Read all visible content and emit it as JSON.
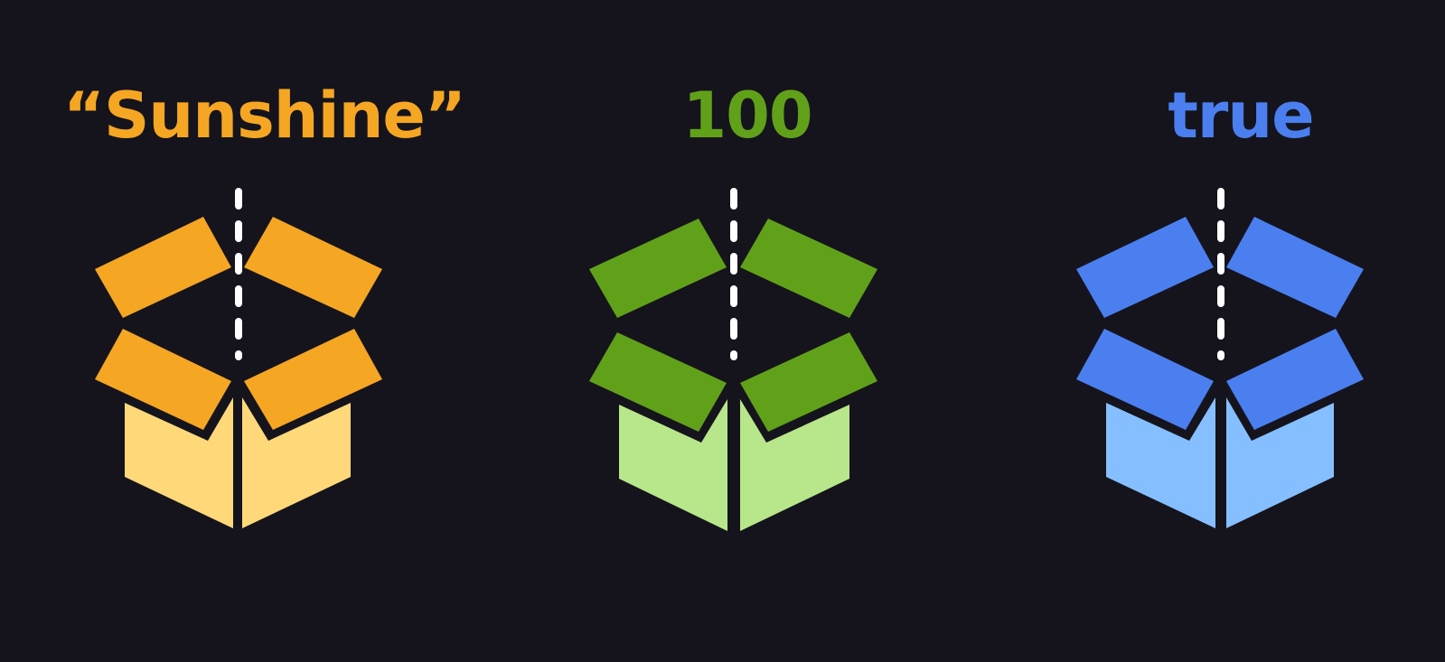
{
  "boxes": [
    {
      "label": "“Sunshine”",
      "label_color": "#f5a623",
      "flap_color": "#f5a623",
      "body_color": "#ffd979",
      "icon": "open-box-icon"
    },
    {
      "label": "100",
      "label_color": "#61a11a",
      "flap_color": "#61a11a",
      "body_color": "#b8e68a",
      "icon": "open-box-icon"
    },
    {
      "label": "true",
      "label_color": "#4b7ff0",
      "flap_color": "#4b7ff0",
      "body_color": "#86bfff",
      "icon": "open-box-icon"
    }
  ],
  "colors": {
    "background": "#15141d",
    "seam": "#ffffff"
  }
}
